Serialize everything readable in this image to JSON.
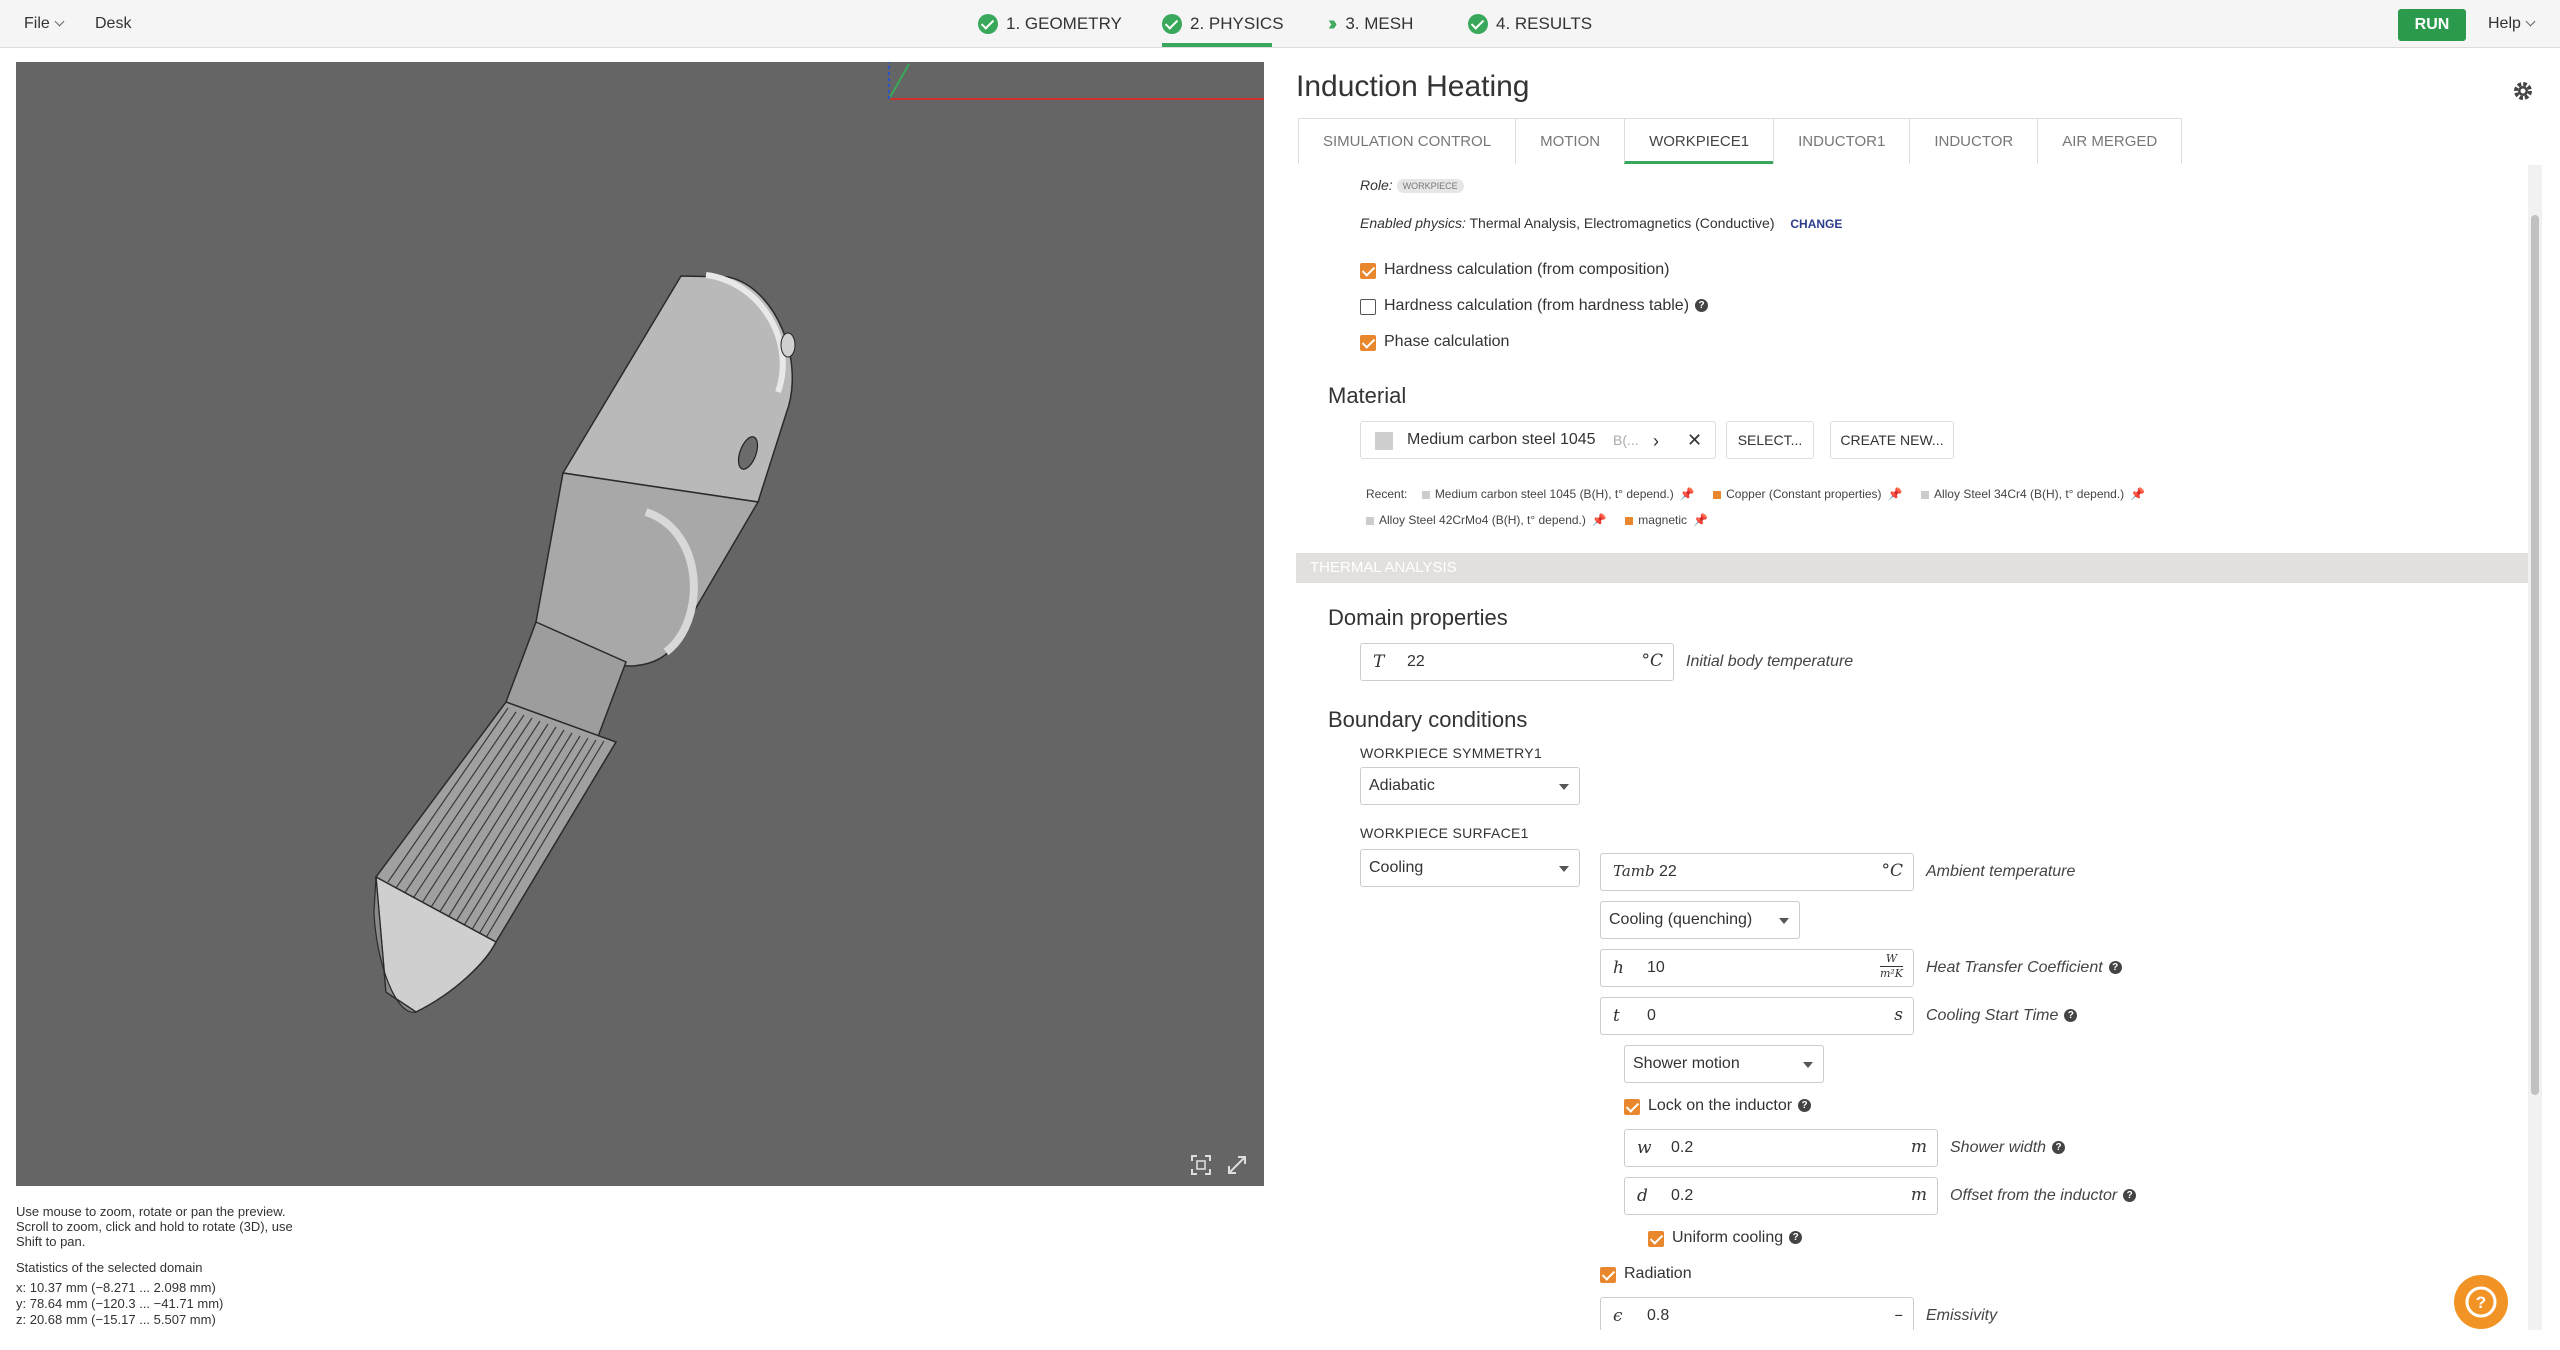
{
  "topbar": {
    "file_label": "File",
    "desk_label": "Desk",
    "steps": [
      {
        "label": "1. GEOMETRY",
        "status": "done"
      },
      {
        "label": "2. PHYSICS",
        "status": "done",
        "active": true
      },
      {
        "label": "3. MESH",
        "status": "next"
      },
      {
        "label": "4. RESULTS",
        "status": "done"
      }
    ],
    "run_label": "RUN",
    "help_label": "Help"
  },
  "viewport": {
    "help_text_1": "Use mouse to zoom, rotate or pan the preview.",
    "help_text_2": "Scroll to zoom, click and hold to rotate (3D), use",
    "help_text_3": "Shift to pan.",
    "stats_title": "Statistics of the selected domain",
    "stats": [
      "x: 10.37 mm  (−8.271 ... 2.098  mm)",
      "y: 78.64 mm  (−120.3 ... −41.71 mm)",
      "z: 20.68 mm  (−15.17 ... 5.507  mm)"
    ]
  },
  "panel": {
    "title": "Induction Heating",
    "tabs": [
      "SIMULATION CONTROL",
      "MOTION",
      "WORKPIECE1",
      "INDUCTOR1",
      "INDUCTOR",
      "AIR MERGED"
    ],
    "active_tab": "WORKPIECE1",
    "role_label": "Role:",
    "role_tag": "WORKPIECE",
    "enabled_physics_label": "Enabled physics:",
    "enabled_physics_value": "Thermal Analysis, Electromagnetics (Conductive)",
    "change_label": "CHANGE",
    "checkboxes": {
      "hardness_composition": {
        "label": "Hardness calculation (from composition)",
        "checked": true
      },
      "hardness_table": {
        "label": "Hardness calculation (from hardness table)",
        "checked": false
      },
      "phase": {
        "label": "Phase calculation",
        "checked": true
      }
    },
    "material": {
      "heading": "Material",
      "selected_name": "Medium carbon steel 1045",
      "selected_suffix": "B(...",
      "select_label": "SELECT...",
      "create_label": "CREATE NEW...",
      "recent_label": "Recent:",
      "recent": [
        {
          "label": "Medium carbon steel 1045 (B(H), t° depend.)",
          "color": "#cccccc"
        },
        {
          "label": "Copper (Constant properties)",
          "color": "#e8872d"
        },
        {
          "label": "Alloy Steel 34Cr4 (B(H), t° depend.)",
          "color": "#cccccc"
        },
        {
          "label": "Alloy Steel 42CrMo4 (B(H), t° depend.)",
          "color": "#cccccc"
        },
        {
          "label": "magnetic",
          "color": "#e8872d"
        }
      ]
    },
    "thermal_band": "THERMAL ANALYSIS",
    "domain_props": {
      "heading": "Domain properties",
      "t_symbol": "T",
      "t_value": "22",
      "t_unit": "°C",
      "t_label": "Initial body temperature"
    },
    "boundary": {
      "heading": "Boundary conditions",
      "sym_label": "WORKPIECE SYMMETRY1",
      "sym_value": "Adiabatic",
      "surf_label": "WORKPIECE SURFACE1",
      "surf_value": "Cooling",
      "tamb_symbol": "Tamb",
      "tamb_value": "22",
      "tamb_unit": "°C",
      "tamb_label": "Ambient temperature",
      "cooling_type": "Cooling (quenching)",
      "h_symbol": "h",
      "h_value": "10",
      "h_unit_num": "W",
      "h_unit_den": "m²K",
      "h_label": "Heat Transfer Coefficient",
      "t_symbol": "t",
      "t_value": "0",
      "t_unit": "s",
      "t_label": "Cooling Start Time",
      "motion_type": "Shower motion",
      "lock_label": "Lock on the inductor",
      "w_symbol": "w",
      "w_value": "0.2",
      "w_unit": "m",
      "w_label": "Shower width",
      "d_symbol": "d",
      "d_value": "0.2",
      "d_unit": "m",
      "d_label": "Offset from the inductor",
      "uniform_label": "Uniform cooling",
      "radiation_label": "Radiation",
      "eps_symbol": "ϵ",
      "eps_value": "0.8",
      "eps_unit": "–",
      "eps_label": "Emissivity"
    }
  },
  "colors": {
    "accent_green": "#3aa85a",
    "run_green": "#2c9a4c",
    "checkbox_orange": "#e8872d",
    "viewport_gray": "#656565"
  }
}
